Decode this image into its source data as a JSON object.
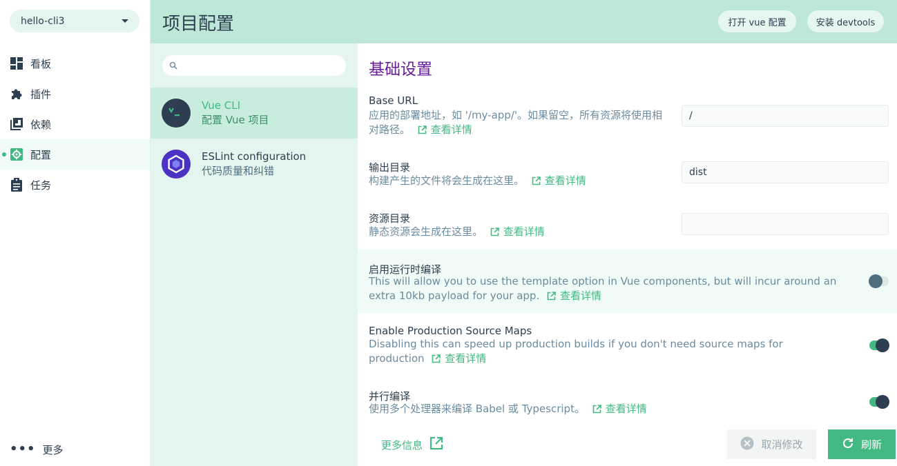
{
  "sidebar": {
    "project": "hello-cli3",
    "items": [
      {
        "label": "看板",
        "icon": "dashboard-icon"
      },
      {
        "label": "插件",
        "icon": "puzzle-icon"
      },
      {
        "label": "依赖",
        "icon": "library-icon"
      },
      {
        "label": "配置",
        "icon": "settings-icon",
        "active": true
      },
      {
        "label": "任务",
        "icon": "clipboard-icon"
      }
    ],
    "more_label": "更多"
  },
  "header": {
    "title": "项目配置",
    "open_vue_config": "打开 vue 配置",
    "install_devtools": "安装 devtools"
  },
  "config_list": {
    "search_placeholder": "",
    "items": [
      {
        "name": "Vue CLI",
        "desc": "配置 Vue 项目",
        "active": true
      },
      {
        "name": "ESLint configuration",
        "desc": "代码质量和纠错",
        "active": false
      }
    ]
  },
  "main": {
    "section_title": "基础设置",
    "link_label": "查看详情",
    "settings": [
      {
        "label": "Base URL",
        "desc": "应用的部署地址，如 '/my-app/'。如果留空，所有资源将使用相对路径。",
        "value": "/"
      },
      {
        "label": "输出目录",
        "desc": "构建产生的文件将会生成在这里。",
        "value": "dist"
      },
      {
        "label": "资源目录",
        "desc": "静态资源会生成在这里。",
        "value": ""
      },
      {
        "label": "启用运行时编译",
        "desc": "This will allow you to use the template option in Vue components, but will incur around an extra 10kb payload for your app.",
        "enabled": false
      },
      {
        "label": "Enable Production Source Maps",
        "desc": "Disabling this can speed up production builds if you don't need source maps for production",
        "enabled": true
      },
      {
        "label": "并行编译",
        "desc": "使用多个处理器来编译 Babel 或 Typescript。",
        "enabled": true
      }
    ],
    "more_info": "更多信息",
    "cancel_label": "取消修改",
    "refresh_label": "刷新"
  },
  "colors": {
    "accent": "#42b983",
    "header_bg": "#bde8d7",
    "dark": "#2c3e50",
    "section_title": "#6a1b9a"
  }
}
